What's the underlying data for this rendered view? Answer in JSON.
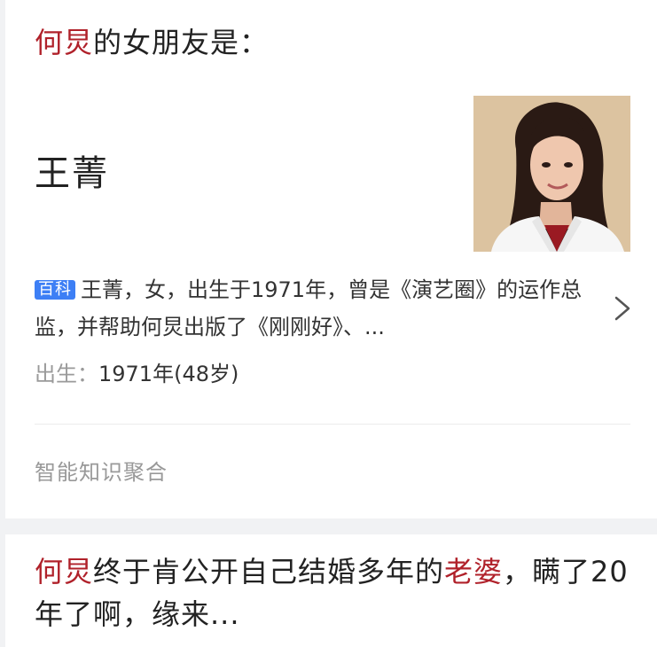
{
  "result_card": {
    "question": {
      "highlight": "何炅",
      "rest": "的女朋友是："
    },
    "answer": "王菁",
    "photo": {
      "alt": "王菁"
    },
    "description": {
      "badge": "百科",
      "text": "王菁，女，出生于1971年，曾是《演艺圈》的运作总监，并帮助何炅出版了《刚刚好》、..."
    },
    "birth": {
      "label": "出生：",
      "value": "1971年(48岁)"
    },
    "footer": "智能知识聚合"
  },
  "article_card": {
    "title_parts": {
      "p1": "何炅",
      "p2": "终于肯公开自己结婚多年的",
      "p3": "老婆",
      "p4": "，瞒了20年了啊，缘来..."
    }
  },
  "colors": {
    "highlight": "#b0212a",
    "badge": "#3d7ff5"
  }
}
